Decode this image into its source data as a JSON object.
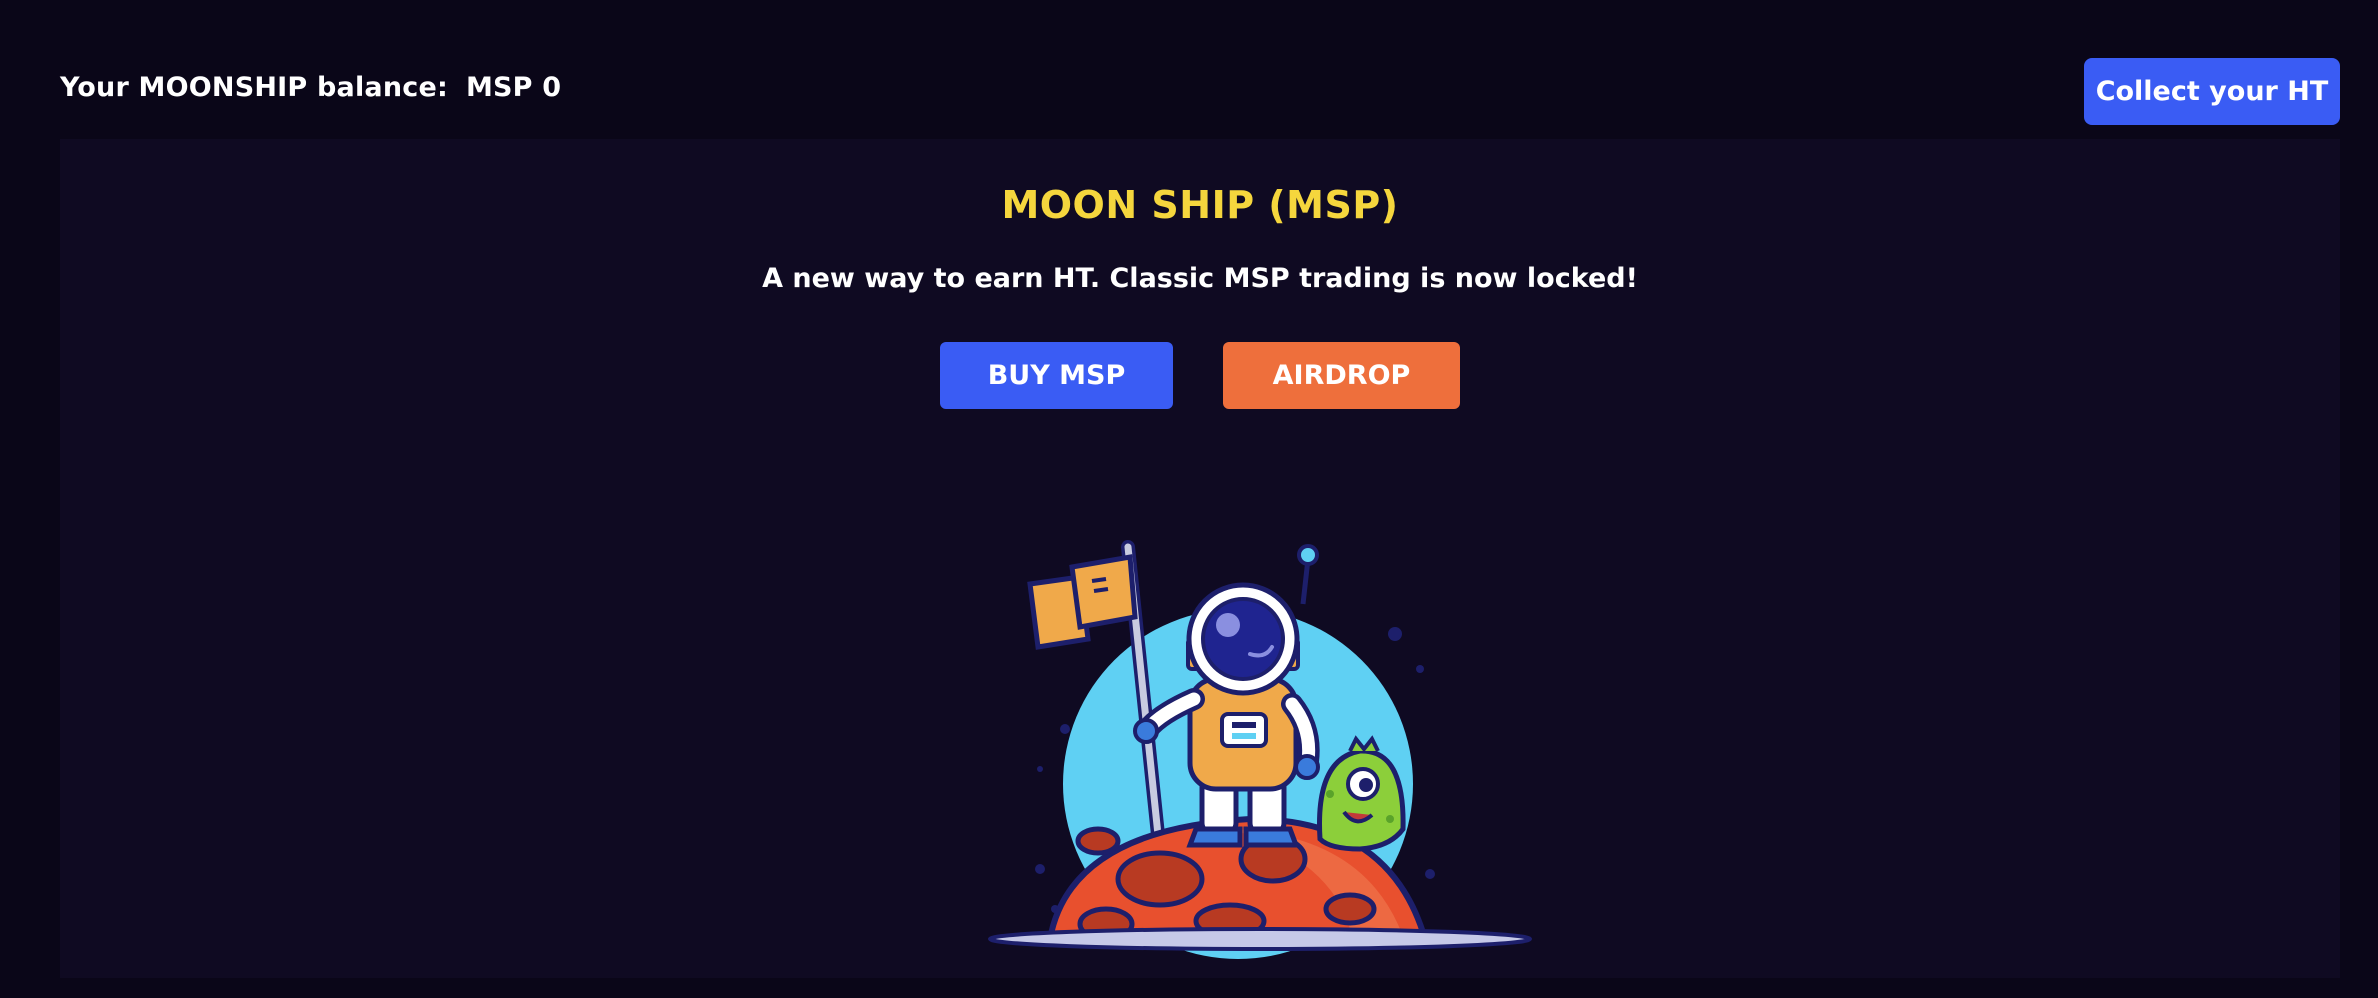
{
  "header": {
    "balance_label": "Your MOONSHIP balance:",
    "balance_value": "MSP 0",
    "collect_label": "Collect your HT"
  },
  "main": {
    "title": "MOON SHIP (MSP)",
    "subtitle": "A new way to earn HT. Classic MSP trading is now locked!",
    "buy_label": "BUY MSP",
    "airdrop_label": "AIRDROP",
    "illustration": "astronaut-on-moon-illustration"
  },
  "colors": {
    "background": "#0a0618",
    "panel": "#0f0a22",
    "title": "#f5d63d",
    "primary_button": "#3a5cf4",
    "airdrop_button": "#ee6f3c"
  }
}
